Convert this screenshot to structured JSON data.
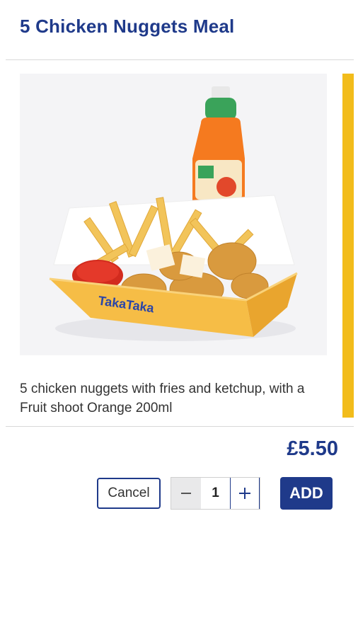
{
  "product": {
    "title": "5 Chicken Nuggets Meal",
    "description": "5 chicken nuggets with fries and ketchup, with a Fruit shoot Orange 200ml",
    "price": "£5.50",
    "image_icon": "meal-photo",
    "brand_colors": {
      "primary": "#1f3a8a",
      "accent": "#f2bc1b"
    }
  },
  "actions": {
    "cancel_label": "Cancel",
    "add_label": "ADD",
    "quantity": "1",
    "decrement_icon": "minus-icon",
    "increment_icon": "plus-icon"
  }
}
